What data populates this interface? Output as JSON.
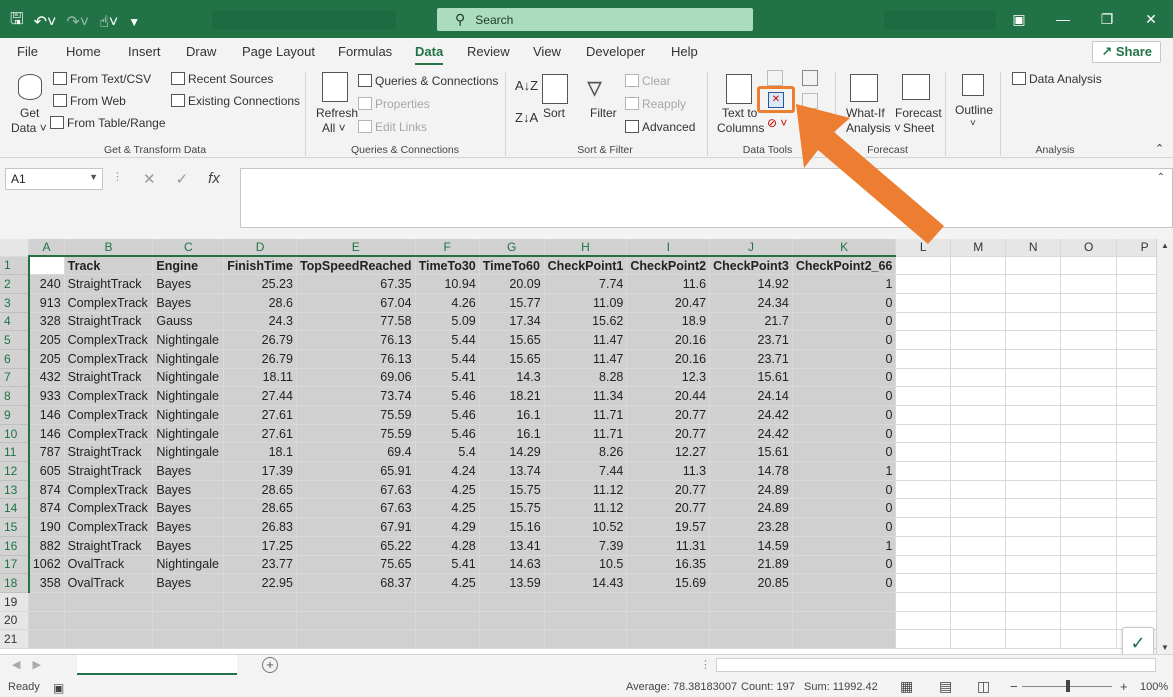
{
  "search": {
    "placeholder": "Search"
  },
  "qat": {
    "save_icon": "save-icon",
    "undo_icon": "undo-icon",
    "redo_icon": "redo-icon",
    "touch_icon": "touch-mode-icon",
    "customize_icon": "customize-icon"
  },
  "tabs": [
    "File",
    "Home",
    "Insert",
    "Draw",
    "Page Layout",
    "Formulas",
    "Data",
    "Review",
    "View",
    "Developer",
    "Help"
  ],
  "active_tab": "Data",
  "share_label": "Share",
  "ribbon": {
    "get_data": [
      "Get",
      "Data"
    ],
    "from_text_csv": "From Text/CSV",
    "from_web": "From Web",
    "from_table": "From Table/Range",
    "recent_sources": "Recent Sources",
    "existing_connections": "Existing Connections",
    "group_get_transform": "Get & Transform Data",
    "refresh_all": [
      "Refresh",
      "All"
    ],
    "queries_connections": "Queries & Connections",
    "properties": "Properties",
    "edit_links": "Edit Links",
    "group_queries": "Queries & Connections",
    "sort": "Sort",
    "filter": "Filter",
    "clear": "Clear",
    "reapply": "Reapply",
    "advanced": "Advanced",
    "group_sort_filter": "Sort & Filter",
    "text_to_columns": [
      "Text to",
      "Columns"
    ],
    "group_data_tools": "Data Tools",
    "what_if": [
      "What-If",
      "Analysis"
    ],
    "forecast_sheet": [
      "Forecast",
      "Sheet"
    ],
    "group_forecast": "Forecast",
    "outline": "Outline",
    "data_analysis": "Data Analysis",
    "group_analysis": "Analysis"
  },
  "formula_bar": {
    "name_box": "A1",
    "fx": "fx",
    "formula": ""
  },
  "columns": [
    "A",
    "B",
    "C",
    "D",
    "E",
    "F",
    "G",
    "H",
    "I",
    "J",
    "K",
    "L",
    "M",
    "N",
    "O",
    "P"
  ],
  "headers": [
    "",
    "Track",
    "Engine",
    "FinishTime",
    "TopSpeedReached",
    "TimeTo30",
    "TimeTo60",
    "CheckPoint1",
    "CheckPoint2",
    "CheckPoint3",
    "CheckPoint2_66"
  ],
  "rows": [
    [
      "240",
      "StraightTrack",
      "Bayes",
      "25.23",
      "67.35",
      "10.94",
      "20.09",
      "7.74",
      "11.6",
      "14.92",
      "1"
    ],
    [
      "913",
      "ComplexTrack",
      "Bayes",
      "28.6",
      "67.04",
      "4.26",
      "15.77",
      "11.09",
      "20.47",
      "24.34",
      "0"
    ],
    [
      "328",
      "StraightTrack",
      "Gauss",
      "24.3",
      "77.58",
      "5.09",
      "17.34",
      "15.62",
      "18.9",
      "21.7",
      "0"
    ],
    [
      "205",
      "ComplexTrack",
      "Nightingale",
      "26.79",
      "76.13",
      "5.44",
      "15.65",
      "11.47",
      "20.16",
      "23.71",
      "0"
    ],
    [
      "205",
      "ComplexTrack",
      "Nightingale",
      "26.79",
      "76.13",
      "5.44",
      "15.65",
      "11.47",
      "20.16",
      "23.71",
      "0"
    ],
    [
      "432",
      "StraightTrack",
      "Nightingale",
      "18.11",
      "69.06",
      "5.41",
      "14.3",
      "8.28",
      "12.3",
      "15.61",
      "0"
    ],
    [
      "933",
      "ComplexTrack",
      "Nightingale",
      "27.44",
      "73.74",
      "5.46",
      "18.21",
      "11.34",
      "20.44",
      "24.14",
      "0"
    ],
    [
      "146",
      "ComplexTrack",
      "Nightingale",
      "27.61",
      "75.59",
      "5.46",
      "16.1",
      "11.71",
      "20.77",
      "24.42",
      "0"
    ],
    [
      "146",
      "ComplexTrack",
      "Nightingale",
      "27.61",
      "75.59",
      "5.46",
      "16.1",
      "11.71",
      "20.77",
      "24.42",
      "0"
    ],
    [
      "787",
      "StraightTrack",
      "Nightingale",
      "18.1",
      "69.4",
      "5.4",
      "14.29",
      "8.26",
      "12.27",
      "15.61",
      "0"
    ],
    [
      "605",
      "StraightTrack",
      "Bayes",
      "17.39",
      "65.91",
      "4.24",
      "13.74",
      "7.44",
      "11.3",
      "14.78",
      "1"
    ],
    [
      "874",
      "ComplexTrack",
      "Bayes",
      "28.65",
      "67.63",
      "4.25",
      "15.75",
      "11.12",
      "20.77",
      "24.89",
      "0"
    ],
    [
      "874",
      "ComplexTrack",
      "Bayes",
      "28.65",
      "67.63",
      "4.25",
      "15.75",
      "11.12",
      "20.77",
      "24.89",
      "0"
    ],
    [
      "190",
      "ComplexTrack",
      "Bayes",
      "26.83",
      "67.91",
      "4.29",
      "15.16",
      "10.52",
      "19.57",
      "23.28",
      "0"
    ],
    [
      "882",
      "StraightTrack",
      "Bayes",
      "17.25",
      "65.22",
      "4.28",
      "13.41",
      "7.39",
      "11.31",
      "14.59",
      "1"
    ],
    [
      "1062",
      "OvalTrack",
      "Nightingale",
      "23.77",
      "75.65",
      "5.41",
      "14.63",
      "10.5",
      "16.35",
      "21.89",
      "0"
    ],
    [
      "358",
      "OvalTrack",
      "Bayes",
      "22.95",
      "68.37",
      "4.25",
      "13.59",
      "14.43",
      "15.69",
      "20.85",
      "0"
    ]
  ],
  "empty_rows": [
    "19",
    "20",
    "21"
  ],
  "status": {
    "ready": "Ready",
    "average": "Average: 78.38183007",
    "count": "Count: 197",
    "sum": "Sum: 11992.42",
    "zoom": "100%",
    "zoom_minus": "−",
    "zoom_plus": "+"
  },
  "colors": {
    "accent": "#217346",
    "highlight": "#ed7d31",
    "selection": "#d0d0d0"
  }
}
